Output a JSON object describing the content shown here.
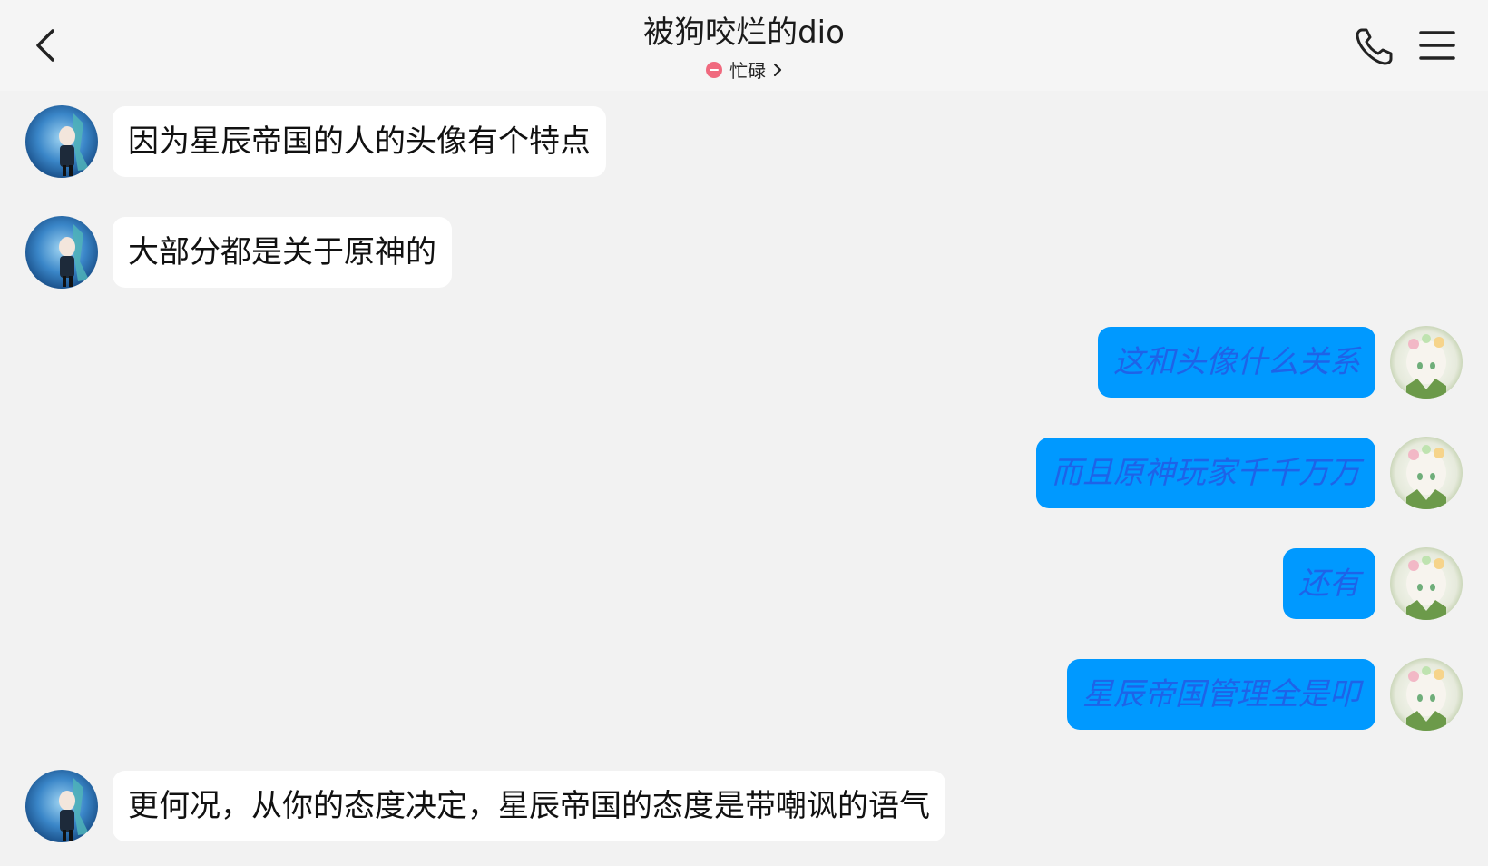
{
  "header": {
    "title": "被狗咬烂的dio",
    "status": "忙碌",
    "status_color": "#f0697e"
  },
  "icons": {
    "back": "chevron-left-icon",
    "phone": "phone-icon",
    "menu": "menu-icon",
    "status_chevron": "chevron-right-icon"
  },
  "colors": {
    "background": "#f2f2f2",
    "incoming_bubble": "#ffffff",
    "outgoing_bubble": "#0099ff",
    "outgoing_text": "#1e63e8"
  },
  "messages": [
    {
      "side": "incoming",
      "text": "因为星辰帝国的人的头像有个特点"
    },
    {
      "side": "incoming",
      "text": "大部分都是关于原神的"
    },
    {
      "side": "outgoing",
      "text": "这和头像什么关系"
    },
    {
      "side": "outgoing",
      "text": "而且原神玩家千千万万"
    },
    {
      "side": "outgoing",
      "text": "还有"
    },
    {
      "side": "outgoing",
      "text": "星辰帝国管理全是叩"
    },
    {
      "side": "incoming",
      "text": "更何况，从你的态度决定，星辰帝国的态度是带嘲讽的语气"
    }
  ]
}
